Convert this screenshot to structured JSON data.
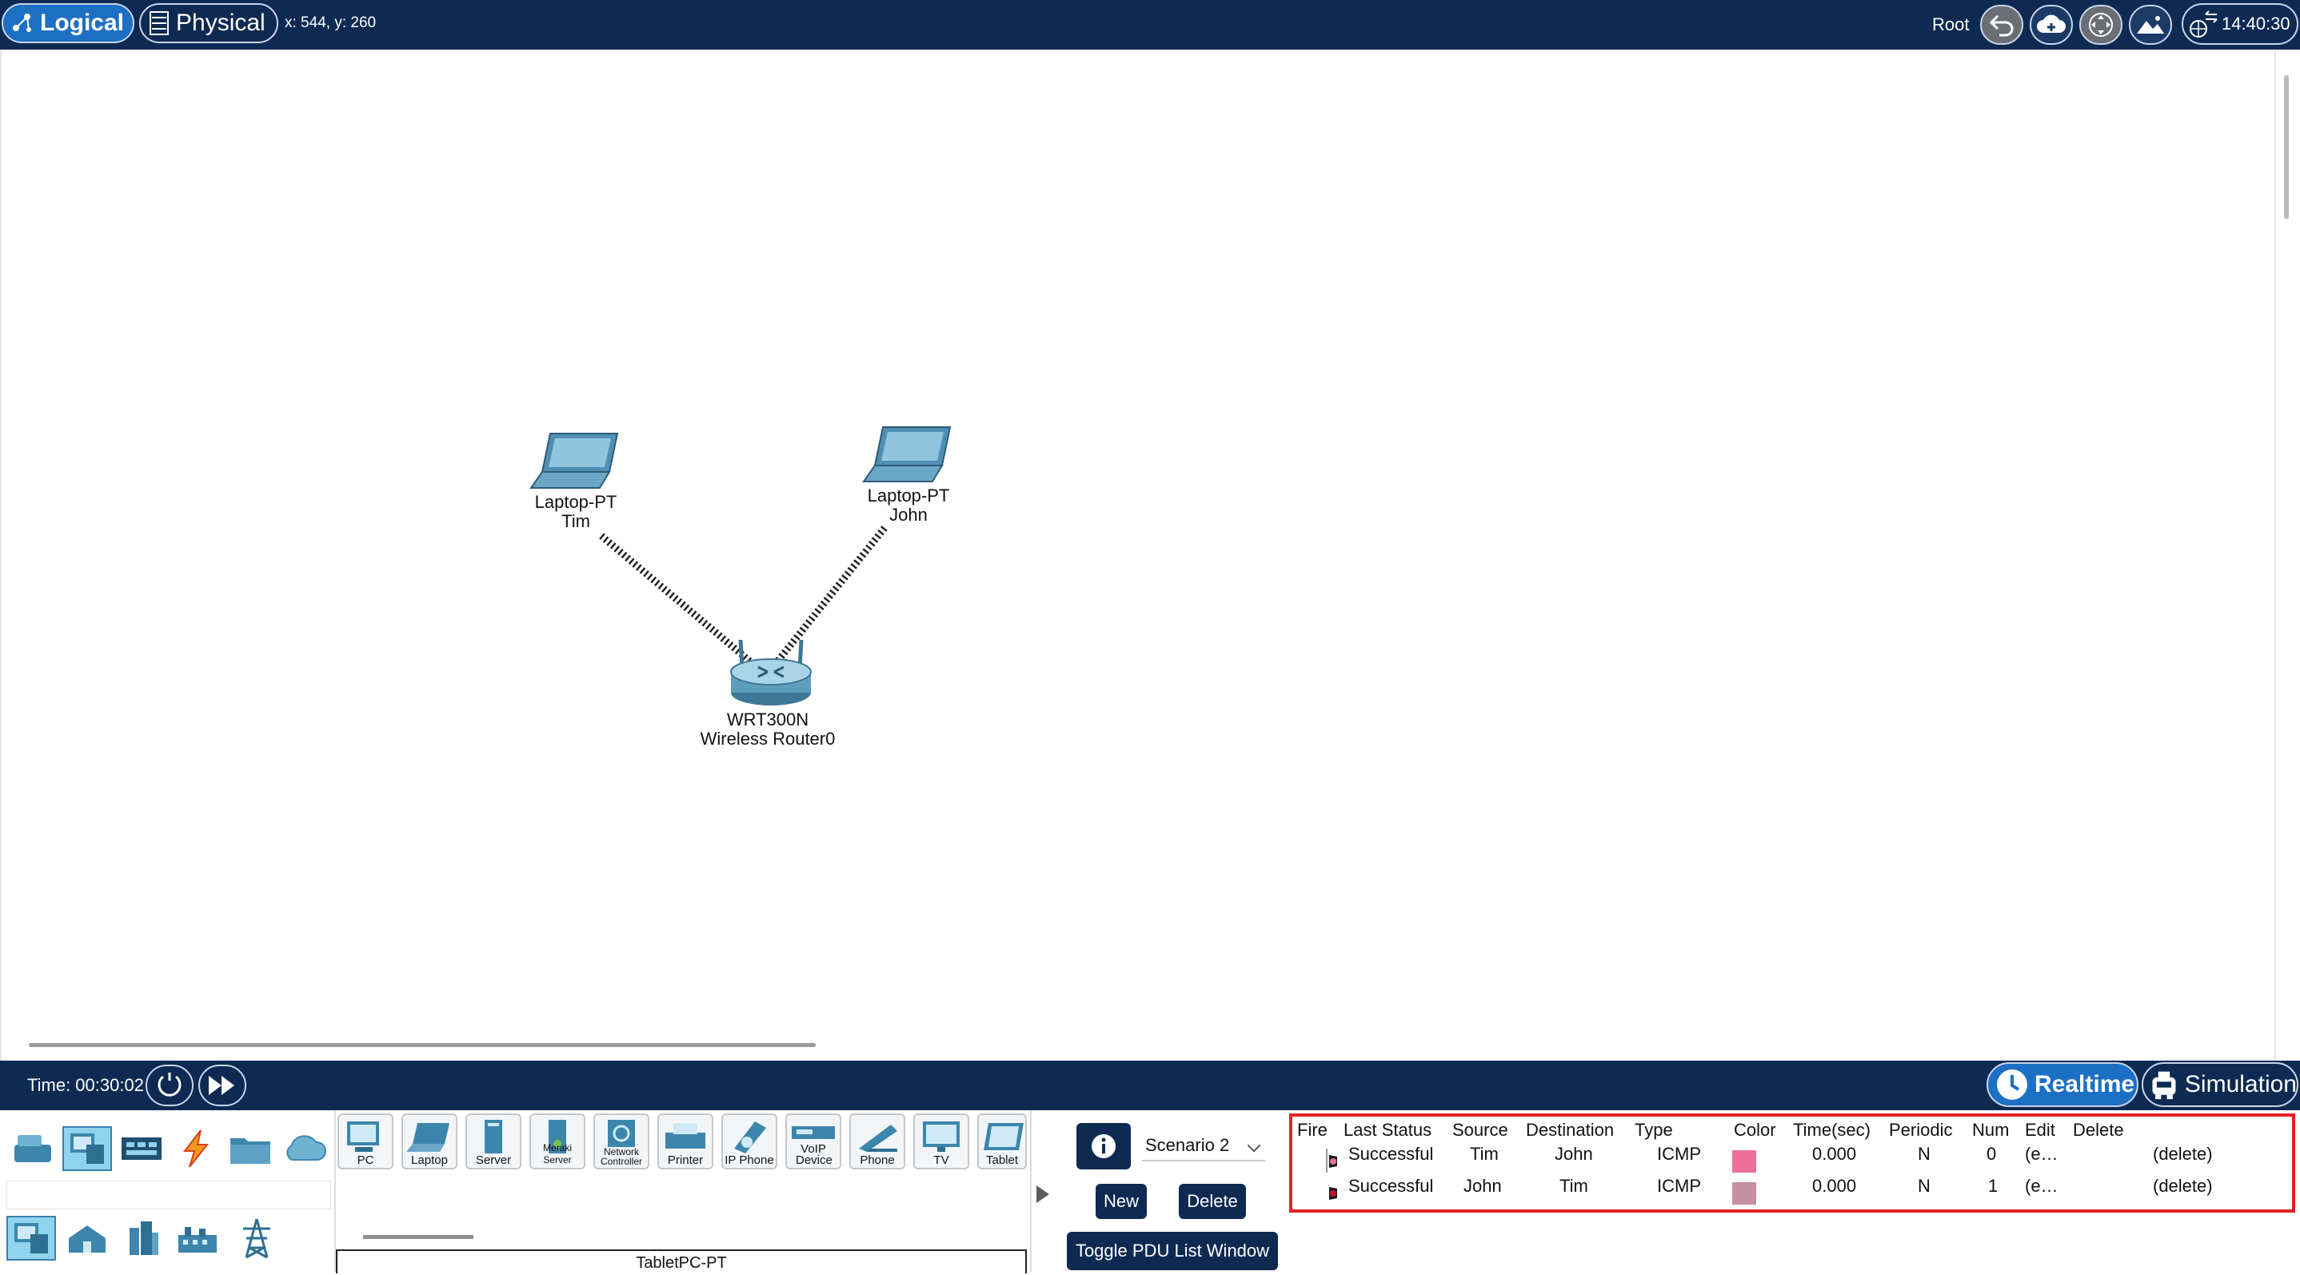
{
  "topbar": {
    "logical_label": "Logical",
    "physical_label": "Physical",
    "coords": "x: 544, y: 260",
    "root_label": "Root",
    "clock": "14:40:30",
    "icons": [
      "back-arrow-icon",
      "cloud-add-icon",
      "move-icon",
      "image-icon",
      "network-clock-icon"
    ]
  },
  "workspace": {
    "devices": [
      {
        "model": "Laptop-PT",
        "name": "Tim",
        "icon": "laptop-icon"
      },
      {
        "model": "Laptop-PT",
        "name": "John",
        "icon": "laptop-icon"
      },
      {
        "model": "WRT300N",
        "name": "Wireless Router0",
        "icon": "wireless-router-icon"
      }
    ],
    "links": [
      "wireless-link-tim-router",
      "wireless-link-john-router"
    ]
  },
  "timebar": {
    "time": "Time: 00:30:02",
    "realtime_label": "Realtime",
    "simulation_label": "Simulation",
    "active_mode": "Realtime"
  },
  "palette": {
    "categories_top": [
      "network-devices-icon",
      "end-devices-icon",
      "components-icon",
      "connections-icon",
      "miscellaneous-icon",
      "multiuser-icon"
    ],
    "categories_bottom": [
      "end-devices-icon",
      "home-icon",
      "smart-city-icon",
      "industrial-icon",
      "power-grid-icon"
    ],
    "devices": [
      "PC",
      "Laptop",
      "Server",
      "Meraki Server",
      "Network Controller",
      "Printer",
      "IP Phone",
      "VoIP Device",
      "Phone",
      "TV",
      "Tablet"
    ],
    "model": "TabletPC-PT"
  },
  "scenario": {
    "selected": "Scenario 2",
    "new_label": "New",
    "delete_label": "Delete",
    "toggle_label": "Toggle PDU List Window"
  },
  "pdu_table": {
    "headers": [
      "Fire",
      "Last Status",
      "Source",
      "Destination",
      "Type",
      "Color",
      "Time(sec)",
      "Periodic",
      "Num",
      "Edit",
      "Delete"
    ],
    "rows": [
      {
        "status": "Successful",
        "source": "Tim",
        "destination": "John",
        "type": "ICMP",
        "color": "#ee6f9a",
        "time": "0.000",
        "periodic": "N",
        "num": "0",
        "edit": "(e…",
        "delete": "(delete)"
      },
      {
        "status": "Successful",
        "source": "John",
        "destination": "Tim",
        "type": "ICMP",
        "color": "#c88fa0",
        "time": "0.000",
        "periodic": "N",
        "num": "1",
        "edit": "(e…",
        "delete": "(delete)"
      }
    ]
  },
  "colors": {
    "bar": "#0e2a52",
    "accent": "#1d6fc4",
    "highlight_border": "#e02424"
  }
}
